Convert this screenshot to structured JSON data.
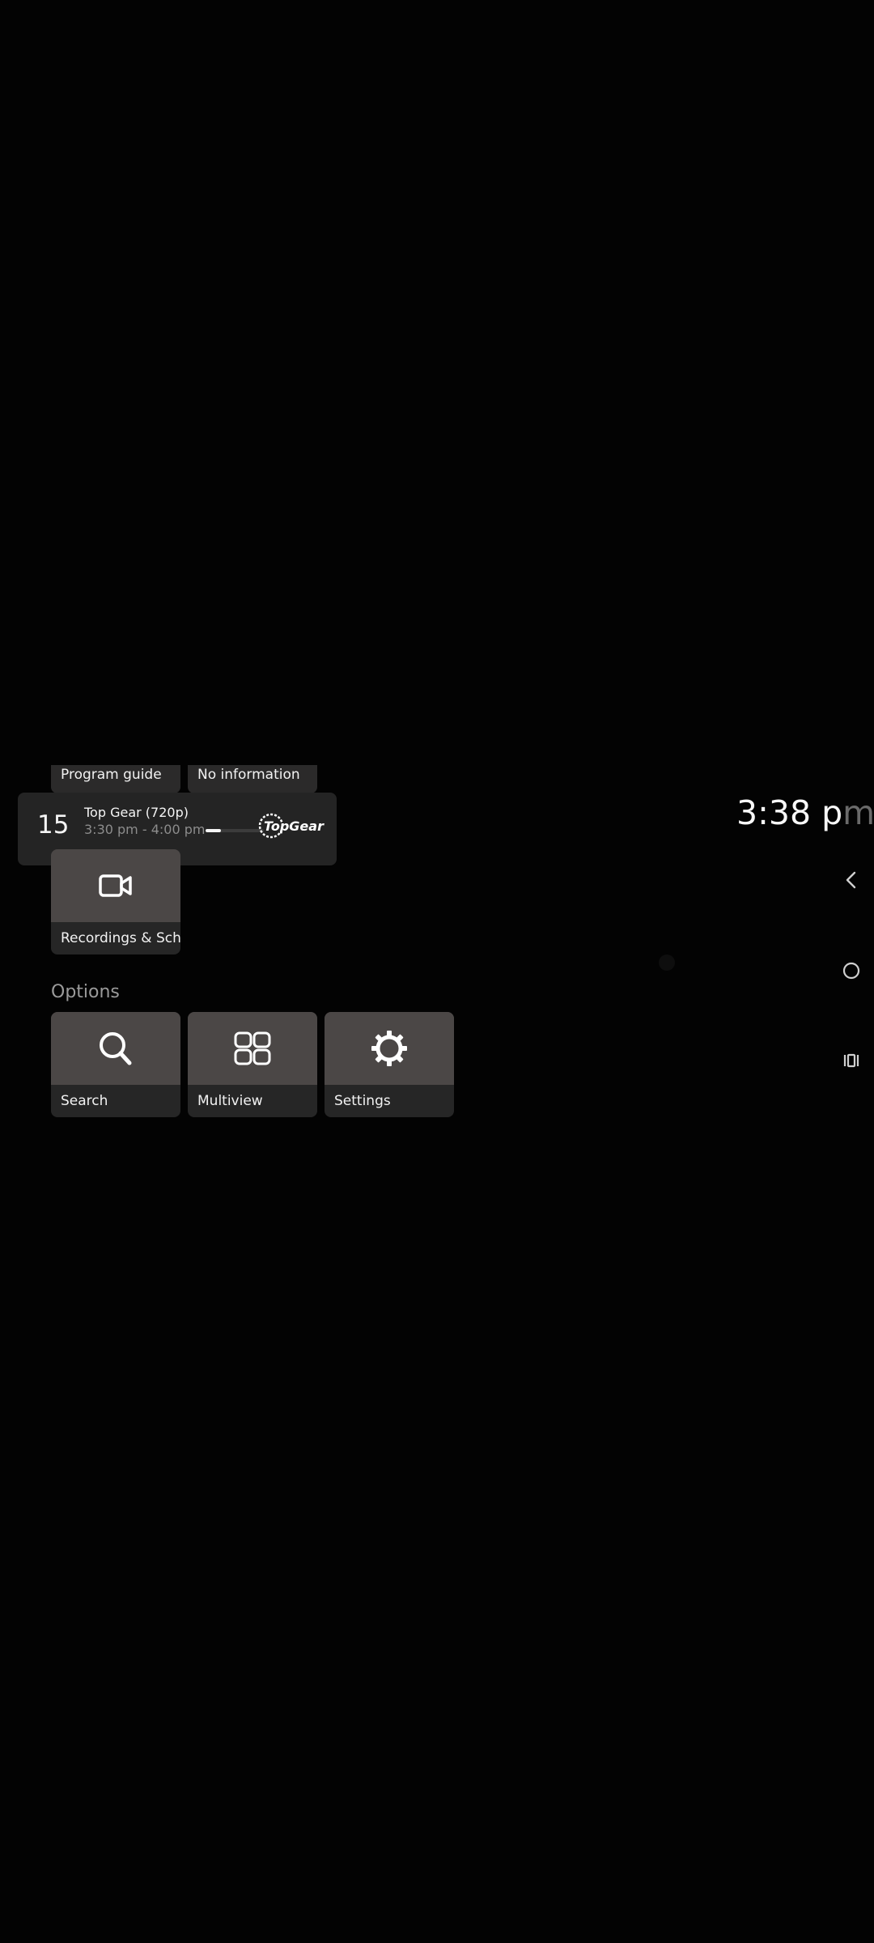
{
  "top_tiles": {
    "left_label": "Program guide",
    "right_label": "No information"
  },
  "channel_card": {
    "number": "15",
    "title": "Top Gear (720p)",
    "time": "3:30 pm - 4:00 pm",
    "progress": 0.27,
    "logo_text": "TopGear"
  },
  "recordings_tile": {
    "label": "Recordings & Sch.."
  },
  "options": {
    "title": "Options",
    "items": [
      {
        "label": "Search",
        "icon": "search-icon"
      },
      {
        "label": "Multiview",
        "icon": "grid-icon"
      },
      {
        "label": "Settings",
        "icon": "gear-icon"
      }
    ]
  },
  "clock": {
    "main": "3:38 p",
    "fade": "m"
  },
  "nav": {
    "back": "back-icon",
    "home": "home-icon",
    "recents": "recents-icon"
  }
}
